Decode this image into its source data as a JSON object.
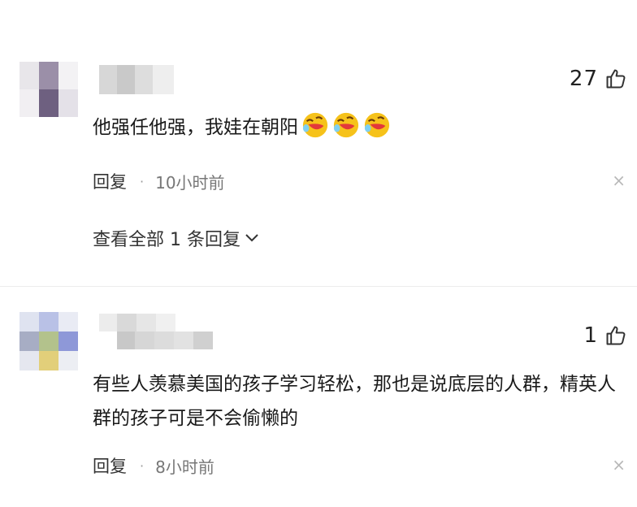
{
  "comments": [
    {
      "likes": "27",
      "text": "他强任他强，我娃在朝阳",
      "emoji_count": 3,
      "reply_label": "回复",
      "separator": "·",
      "time": "10小时前",
      "close_glyph": "×",
      "view_all": "查看全部 1 条回复"
    },
    {
      "likes": "1",
      "text": "有些人羡慕美国的孩子学习轻松，那也是说底层的人群，精英人群的孩子可是不会偷懒的",
      "reply_label": "回复",
      "separator": "·",
      "time": "8小时前",
      "close_glyph": "×"
    }
  ],
  "icons": {
    "like": "thumbs-up-outline-icon",
    "emoji": "face-with-tears-of-joy-rolling-icon",
    "expand": "chevron-down-icon",
    "close": "close-icon"
  },
  "colors": {
    "text": "#1a1a1a",
    "meta": "#777777",
    "emoji_yellow": "#f6c21a",
    "emoji_red": "#e3383a"
  }
}
